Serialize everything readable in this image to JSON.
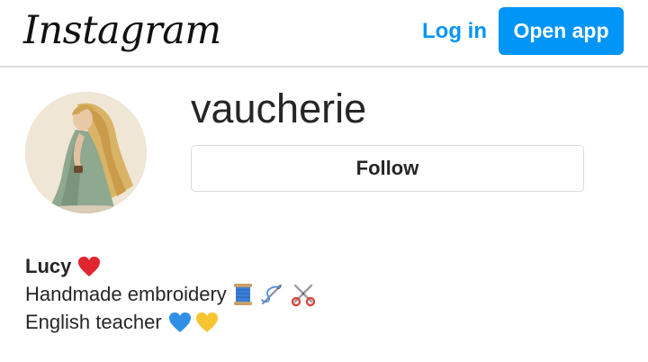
{
  "header": {
    "logo_text": "Instagram",
    "login_label": "Log in",
    "open_app_label": "Open app",
    "accent_color": "#0095f6"
  },
  "profile": {
    "username": "vaucherie",
    "follow_label": "Follow",
    "avatar_icon": "profile-illustration-woman-long-hair"
  },
  "bio": {
    "name": "Lucy",
    "name_emoji_icon": "red-heart-icon",
    "lines": [
      {
        "text": "Handmade embroidery",
        "emoji_icons": [
          "spool-of-thread-icon",
          "needle-and-thread-icon",
          "scissors-icon"
        ]
      },
      {
        "text": "English teacher",
        "emoji_icons": [
          "blue-heart-icon",
          "yellow-heart-icon"
        ]
      }
    ]
  }
}
